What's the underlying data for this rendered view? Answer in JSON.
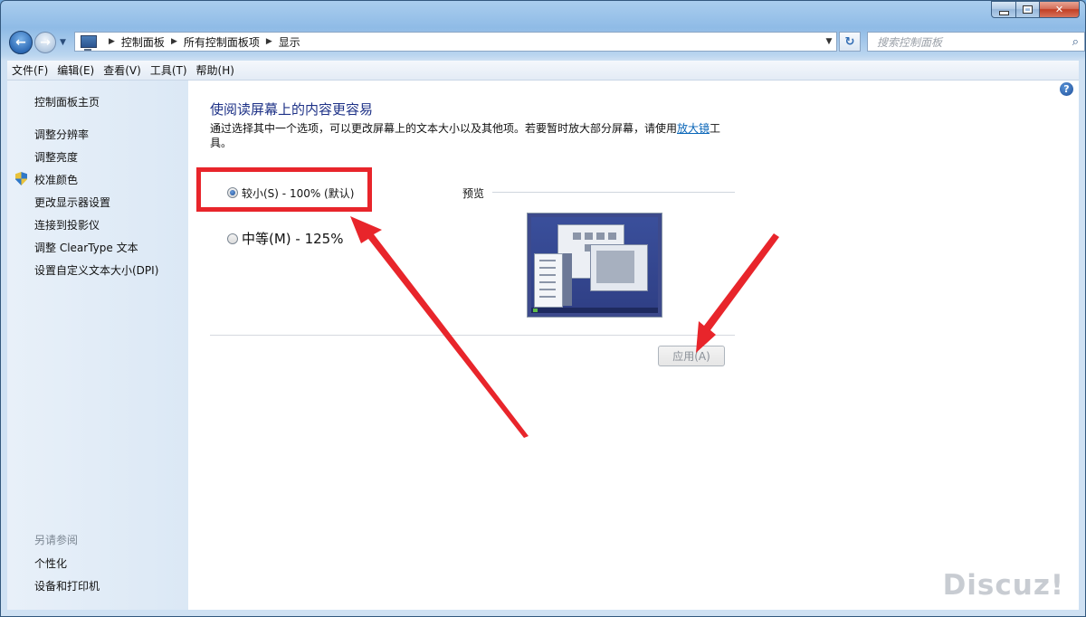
{
  "window": {
    "buttons": {
      "minimize": "",
      "maximize": "",
      "close": "✕"
    }
  },
  "nav": {
    "back_icon": "arrow-left-icon",
    "forward_icon": "arrow-right-icon",
    "breadcrumb": [
      "控制面板",
      "所有控制面板项",
      "显示"
    ],
    "search_placeholder": "搜索控制面板"
  },
  "menubar": {
    "items": [
      "文件(F)",
      "编辑(E)",
      "查看(V)",
      "工具(T)",
      "帮助(H)"
    ]
  },
  "sidebar": {
    "home": "控制面板主页",
    "items": [
      "调整分辨率",
      "调整亮度",
      "校准颜色",
      "更改显示器设置",
      "连接到投影仪",
      "调整 ClearType 文本",
      "设置自定义文本大小(DPI)"
    ],
    "see_also_heading": "另请参阅",
    "see_also": [
      "个性化",
      "设备和打印机"
    ]
  },
  "main": {
    "title": "使阅读屏幕上的内容更容易",
    "description_prefix": "通过选择其中一个选项，可以更改屏幕上的文本大小以及其他项。若要暂时放大部分屏幕，请使用",
    "description_link": "放大镜",
    "description_suffix": "工具。",
    "options": [
      {
        "label": "较小(S) - 100% (默认)",
        "selected": true
      },
      {
        "label": "中等(M) - 125%",
        "selected": false
      }
    ],
    "preview_label": "预览",
    "apply_button": "应用(A)",
    "help_icon": "?"
  },
  "annotation_color": "#e8252b",
  "watermark": "Discuz!"
}
